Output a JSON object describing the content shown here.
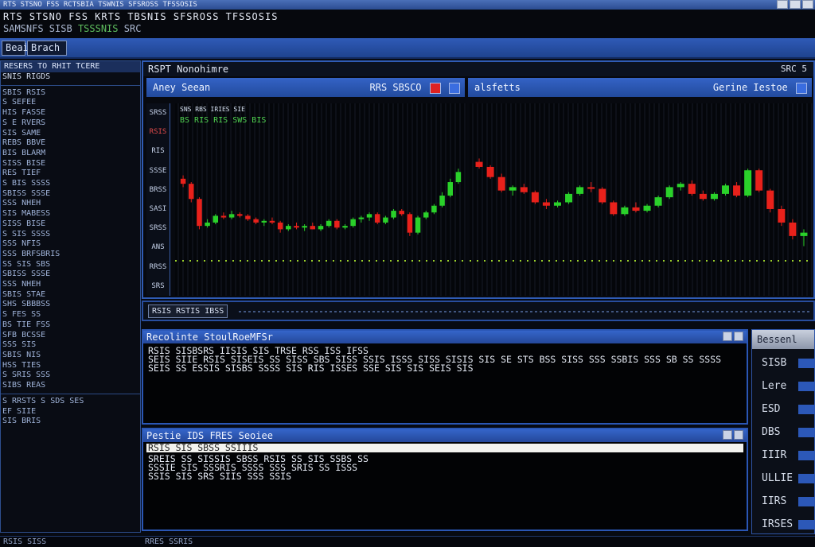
{
  "window": {
    "title": "RTS STSNO FSS RCTSBIA TSWNIS SFSROSS TFSSOSIS",
    "header_line1": "RTS STSNO FSS KRTS TBSNIS SFSROSS TFSSOSIS",
    "header_line2_prefix": "SAMSNFS SISB",
    "header_line2_green": "TSSSNIS",
    "header_line2_suffix": "SRC"
  },
  "toolbar": {
    "buttons": [
      "Beai",
      "Brach"
    ]
  },
  "sidebar": {
    "header": "RESERS TO RHIT TCERE",
    "subheader": "SNIS RIGDS",
    "lines": [
      "SBIS RSIS",
      "S SEFEE",
      "HIS FASSE",
      "S E RVERS",
      "SIS SAME",
      "REBS BBVE",
      "BIS BLARM",
      "SISS BISE",
      "RES TIEF",
      "S BIS SSSS",
      "SBISS SSSE",
      "SSS NHEH",
      "SIS MABESS",
      "SISS BISE",
      "S SIS SSSS",
      "SSS NFIS",
      "SSS BRFSBRIS",
      "SS SIS SBS",
      "SBISS SSSE",
      "SSS NHEH",
      "SBIS STAE",
      "SHS SBBBSS",
      "S FES SS",
      "BS TIE FSS",
      "SFB BCSSE",
      "SSS SIS",
      "SBIS NIS",
      "HSS TIES",
      "S SRIS SSS",
      "SIBS REAS"
    ],
    "footer_lines": [
      "S RRSTS S SDS SES",
      "EF SIIE",
      "SIS BRIS"
    ]
  },
  "chart_window": {
    "title": "RSPT Nonohimre",
    "title_right": "SRC 5"
  },
  "left_pane": {
    "header": "Aney Seean",
    "header_right": "RRS SBSCO",
    "legend_line1": "SNS RBS IRIES SIE",
    "legend_line2": "BS RIS RIS SWS BIS",
    "axis_labels": [
      "SRSS",
      "RSIS",
      "RIS",
      "SSSE",
      "BRSS",
      "SASI",
      "SRSS",
      "ANS",
      "RRSS",
      "SRS"
    ]
  },
  "right_pane": {
    "header": "alsfetts",
    "header_right": "Gerine Iestoe"
  },
  "status_strip": {
    "label": "RSIS RSTIS IBSS"
  },
  "console1": {
    "title": "Recolinte StoulRoeMFSr",
    "lines": [
      "RSIS SISBSRS IISIS SIS TRSE RSS ISS IFSS",
      "SEIS SIIE RSIS SISEIS SS SISS SBS SISS SSIS ISSS SISS SISIS SIS SE STS BSS SISS SSS SSBIS SSS SB SS SSSS",
      "SEIS SS ESSIS SISBS SSSS SIS RIS ISSES SSE SIS SIS SEIS SIS"
    ]
  },
  "console2": {
    "title": "Pestie IDS FRES Seoiee",
    "highlight": "RSIS SIS SBSS SSIIIS",
    "lines": [
      "SREIS SS SISSIS SBSS RSIS SS SIS SSBS SS",
      "SSSIE SIS SSSRIS SSSS SSS SRIS SS ISSS",
      "SSIS SIS SRS SIIS SSS SSIS"
    ]
  },
  "right_panel": {
    "title": "Bessenl",
    "rows": [
      "SISB",
      "Lere",
      "ESD",
      "DBS",
      "IIIR",
      "ULLIE",
      "IIRS",
      "IRSES"
    ]
  },
  "bottom_bar": {
    "left": "RSIS SISS",
    "center": "RRES SSRIS"
  },
  "colors": {
    "up": "#2ad12a",
    "down": "#e8211b",
    "baseline": "#9bd12b",
    "accent": "#2f5bb4"
  },
  "chart_data": [
    {
      "type": "candlestick",
      "series": [
        {
          "values": [
            [
              60,
              62,
              55,
              57
            ],
            [
              57,
              58,
              46,
              48
            ],
            [
              48,
              49,
              30,
              32
            ],
            [
              32,
              36,
              31,
              34
            ],
            [
              34,
              39,
              33,
              38
            ],
            [
              38,
              40,
              36,
              37
            ],
            [
              37,
              41,
              36,
              39
            ],
            [
              39,
              40,
              37,
              38
            ],
            [
              38,
              39,
              35,
              36
            ],
            [
              36,
              37,
              33,
              34
            ],
            [
              34,
              36,
              32,
              35
            ],
            [
              35,
              37,
              33,
              34
            ],
            [
              34,
              35,
              28,
              30
            ],
            [
              30,
              33,
              29,
              32
            ],
            [
              32,
              34,
              30,
              31
            ],
            [
              31,
              33,
              29,
              32
            ],
            [
              32,
              34,
              30,
              30
            ],
            [
              30,
              33,
              29,
              32
            ],
            [
              32,
              36,
              31,
              35
            ],
            [
              35,
              36,
              30,
              31
            ],
            [
              31,
              33,
              30,
              32
            ],
            [
              32,
              37,
              31,
              36
            ],
            [
              36,
              38,
              34,
              37
            ],
            [
              37,
              40,
              35,
              39
            ],
            [
              39,
              40,
              33,
              34
            ],
            [
              34,
              38,
              33,
              37
            ],
            [
              37,
              42,
              36,
              41
            ],
            [
              41,
              42,
              38,
              39
            ],
            [
              39,
              40,
              26,
              28
            ],
            [
              28,
              38,
              27,
              37
            ],
            [
              37,
              41,
              36,
              40
            ],
            [
              40,
              45,
              39,
              44
            ],
            [
              44,
              52,
              43,
              50
            ],
            [
              50,
              60,
              49,
              58
            ],
            [
              58,
              66,
              57,
              64
            ]
          ]
        }
      ]
    },
    {
      "type": "candlestick",
      "series": [
        {
          "values": [
            [
              70,
              72,
              66,
              67
            ],
            [
              67,
              68,
              60,
              61
            ],
            [
              61,
              63,
              52,
              53
            ],
            [
              53,
              56,
              50,
              55
            ],
            [
              55,
              57,
              51,
              52
            ],
            [
              52,
              53,
              45,
              46
            ],
            [
              46,
              48,
              42,
              44
            ],
            [
              44,
              47,
              43,
              46
            ],
            [
              46,
              52,
              45,
              51
            ],
            [
              51,
              56,
              50,
              55
            ],
            [
              55,
              58,
              52,
              54
            ],
            [
              54,
              55,
              45,
              46
            ],
            [
              46,
              47,
              38,
              39
            ],
            [
              39,
              44,
              38,
              43
            ],
            [
              43,
              46,
              40,
              41
            ],
            [
              41,
              45,
              40,
              44
            ],
            [
              44,
              50,
              43,
              49
            ],
            [
              49,
              56,
              48,
              55
            ],
            [
              55,
              58,
              53,
              57
            ],
            [
              57,
              59,
              50,
              51
            ],
            [
              51,
              53,
              47,
              48
            ],
            [
              48,
              52,
              47,
              51
            ],
            [
              51,
              57,
              50,
              56
            ],
            [
              56,
              58,
              49,
              50
            ],
            [
              50,
              66,
              49,
              65
            ],
            [
              65,
              66,
              52,
              53
            ],
            [
              53,
              54,
              40,
              42
            ],
            [
              42,
              44,
              32,
              34
            ],
            [
              34,
              36,
              24,
              26
            ],
            [
              26,
              30,
              20,
              28
            ]
          ]
        }
      ]
    }
  ]
}
